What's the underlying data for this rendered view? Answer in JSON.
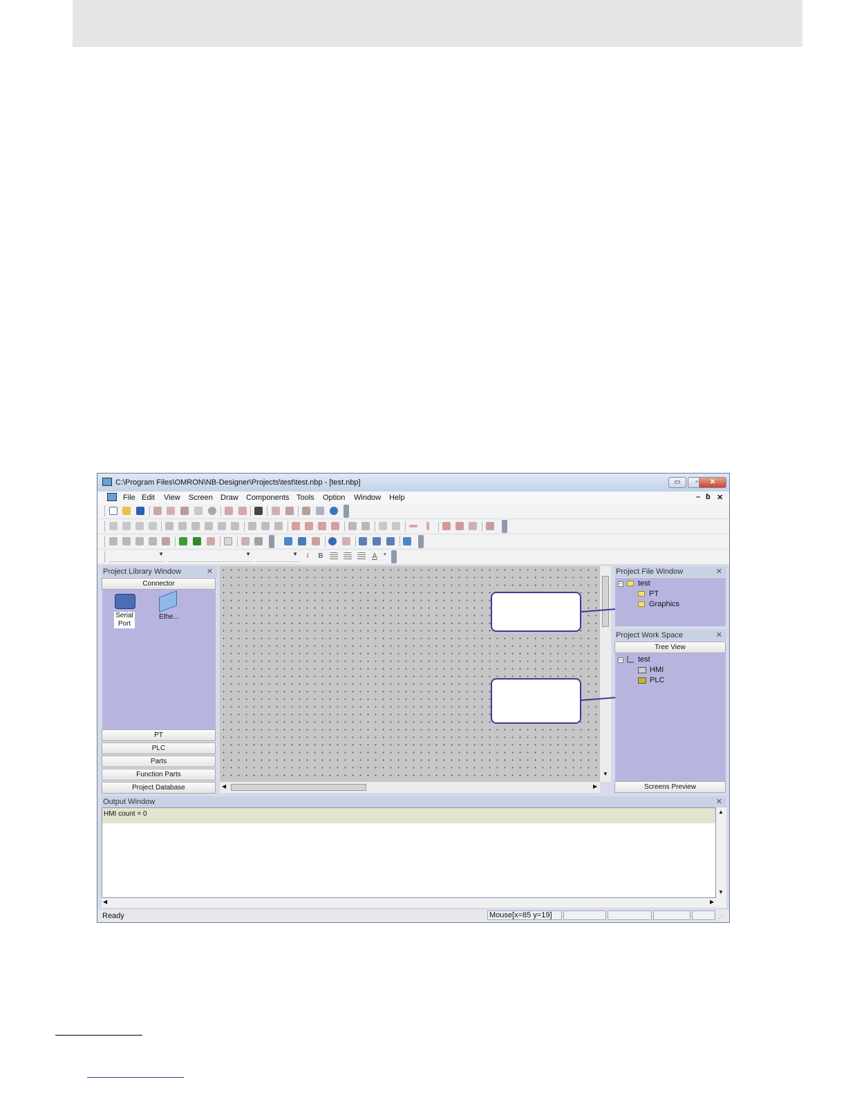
{
  "window": {
    "title": "C:\\Program Files\\OMRON\\NB-Designer\\Projects\\test\\test.nbp - [test.nbp]",
    "controls": {
      "minimize": "▭",
      "maximize": "▫",
      "close": "✕"
    }
  },
  "menu": {
    "items": [
      "File",
      "Edit",
      "View",
      "Screen",
      "Draw",
      "Components",
      "Tools",
      "Option",
      "Window",
      "Help"
    ],
    "mdi_controls": {
      "minimize": "–",
      "restore": "ɓ",
      "close": "✕"
    }
  },
  "library_panel": {
    "title": "Project Library Window",
    "active_tab": "Connector",
    "items": [
      {
        "label_line1": "Serial",
        "label_line2": "Port",
        "icon": "serial-port-icon"
      },
      {
        "label_line1": "Ethe...",
        "label_line2": "",
        "icon": "ethernet-icon"
      }
    ],
    "tabs": [
      "PT",
      "PLC",
      "Parts",
      "Function Parts",
      "Project Database"
    ]
  },
  "file_panel": {
    "title": "Project File Window",
    "tree": {
      "root": "test",
      "children": [
        "PT",
        "Graphics"
      ]
    }
  },
  "workspace_panel": {
    "title": "Project Work Space",
    "top_tab": "Tree View",
    "tree": {
      "root": "test",
      "children": [
        "HMI",
        "PLC"
      ]
    },
    "bottom_tab": "Screens Preview"
  },
  "output_panel": {
    "title": "Output Window",
    "line": "HMI count = 0"
  },
  "status": {
    "text": "Ready",
    "mouse": "Mouse[x=85  y=19]"
  },
  "colors": {
    "panel_lavender": "#b7b5e0",
    "callout_border": "#3b3b93",
    "canvas_gray": "#c6c6c6"
  }
}
